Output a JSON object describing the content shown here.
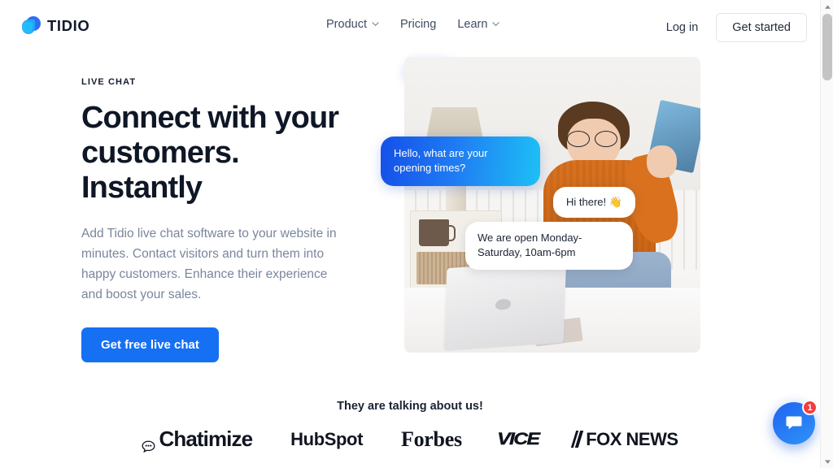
{
  "header": {
    "brand_name": "TIDIO",
    "nav": [
      {
        "label": "Product",
        "has_dropdown": true
      },
      {
        "label": "Pricing",
        "has_dropdown": false
      },
      {
        "label": "Learn",
        "has_dropdown": true
      }
    ],
    "login_label": "Log in",
    "get_started_label": "Get started"
  },
  "hero": {
    "eyebrow": "LIVE CHAT",
    "title": "Connect with your customers. Instantly",
    "description": "Add Tidio live chat software to your website in minutes. Contact visitors and turn them into happy customers. Enhance their experience and boost your sales.",
    "cta_label": "Get free live chat",
    "chat_bubbles": [
      {
        "id": "incoming",
        "text": "Hello, what are your opening times?",
        "side": "left",
        "style": "blue-gradient"
      },
      {
        "id": "greeting",
        "text": "Hi there! 👋",
        "side": "right",
        "style": "white"
      },
      {
        "id": "hours",
        "text": "We are open Monday-Saturday, 10am-6pm",
        "side": "left",
        "style": "white"
      },
      {
        "id": "typing",
        "text": "",
        "side": "left",
        "style": "blue-gradient-typing"
      }
    ]
  },
  "social_proof": {
    "title": "They are talking about us!",
    "logos": [
      {
        "name": "Chatimize",
        "label": "Chatimize"
      },
      {
        "name": "HubSpot",
        "label": "HubSpot"
      },
      {
        "name": "Forbes",
        "label": "Forbes"
      },
      {
        "name": "VICE",
        "label": "VICE"
      },
      {
        "name": "FOX NEWS",
        "label": "FOX NEWS"
      }
    ]
  },
  "chat_widget": {
    "badge_count": "1",
    "icon": "chat-bubble-icon"
  },
  "colors": {
    "primary_blue": "#1570f4",
    "gradient_start": "#1550e8",
    "gradient_end": "#1ec0f5",
    "heading": "#0f1726",
    "body_text": "#7a869c",
    "badge_red": "#f03d3d"
  }
}
